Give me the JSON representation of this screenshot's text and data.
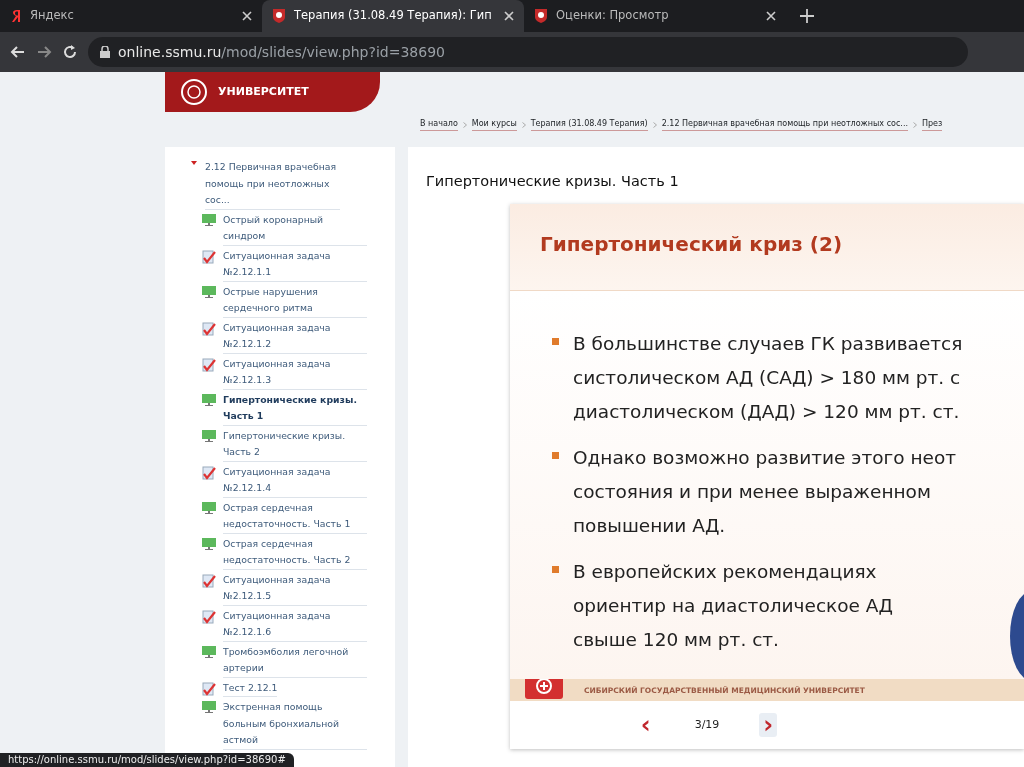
{
  "browser": {
    "tabs": [
      {
        "kind": "yandex",
        "label": "Яндекс",
        "selected": false
      },
      {
        "kind": "site",
        "label": "Терапия (31.08.49 Терапия): Гип",
        "selected": true
      },
      {
        "kind": "site",
        "label": "Оценки: Просмотр",
        "selected": false
      }
    ],
    "url_host": "online.ssmu.ru",
    "url_path": "/mod/slides/view.php?id=38690",
    "status_url": "https://online.ssmu.ru/mod/slides/view.php?id=38690#"
  },
  "logo": {
    "text": "УНИВЕРСИТЕТ"
  },
  "breadcrumb": [
    "В начало",
    "Мои курсы",
    "Терапия (31.08.49 Терапия)",
    "2.12 Первичная врачебная помощь при неотложных сос...",
    "През"
  ],
  "sidebar": {
    "section": {
      "label": "2.12 Первичная врачебная помощь при неотложных сос...",
      "expanded": true,
      "children": [
        {
          "kind": "slides",
          "label": "Острый коронарный синдром",
          "selected": false
        },
        {
          "kind": "task",
          "label": "Ситуационная задача №2.12.1.1",
          "selected": false
        },
        {
          "kind": "slides",
          "label": "Острые нарушения сердечного ритма",
          "selected": false
        },
        {
          "kind": "task",
          "label": "Ситуационная задача №2.12.1.2",
          "selected": false
        },
        {
          "kind": "task",
          "label": "Ситуационная задача №2.12.1.3",
          "selected": false
        },
        {
          "kind": "slides",
          "label": "Гипертонические кризы. Часть 1",
          "selected": true
        },
        {
          "kind": "slides",
          "label": "Гипертонические кризы. Часть 2",
          "selected": false
        },
        {
          "kind": "task",
          "label": "Ситуационная задача №2.12.1.4",
          "selected": false
        },
        {
          "kind": "slides",
          "label": "Острая сердечная недостаточность. Часть 1",
          "selected": false
        },
        {
          "kind": "slides",
          "label": "Острая сердечная недостаточность. Часть 2",
          "selected": false
        },
        {
          "kind": "task",
          "label": "Ситуационная задача №2.12.1.5",
          "selected": false
        },
        {
          "kind": "task",
          "label": "Ситуационная задача №2.12.1.6",
          "selected": false
        },
        {
          "kind": "slides",
          "label": "Тромбоэмболия легочной артерии",
          "selected": false
        },
        {
          "kind": "task",
          "label": "Тест 2.12.1",
          "selected": false
        },
        {
          "kind": "slides",
          "label": "Экстренная помощь больным бронхиальной астмой",
          "selected": false
        }
      ]
    }
  },
  "main": {
    "title": "Гипертонические кризы. Часть 1",
    "slide": {
      "title": "Гипертонический криз (2)",
      "bullets": [
        [
          "В большинстве случаев ГК развивается",
          "систолическом АД (САД)  > 180 мм рт. с",
          "диастолическом (ДАД) > 120 мм рт. ст."
        ],
        [
          "Однако возможно развитие этого неот",
          "состояния и при менее выраженном",
          "повышении АД."
        ],
        [
          "В европейских рекомендациях",
          "ориентир на диастолическое АД",
          "свыше 120 мм рт. ст."
        ]
      ],
      "footer": "СИБИРСКИЙ ГОСУДАРСТВЕННЫЙ МЕДИЦИНСКИЙ УНИВЕРСИТЕТ"
    },
    "pager": {
      "prev": "‹",
      "counter": "3/19",
      "next": "›"
    }
  }
}
